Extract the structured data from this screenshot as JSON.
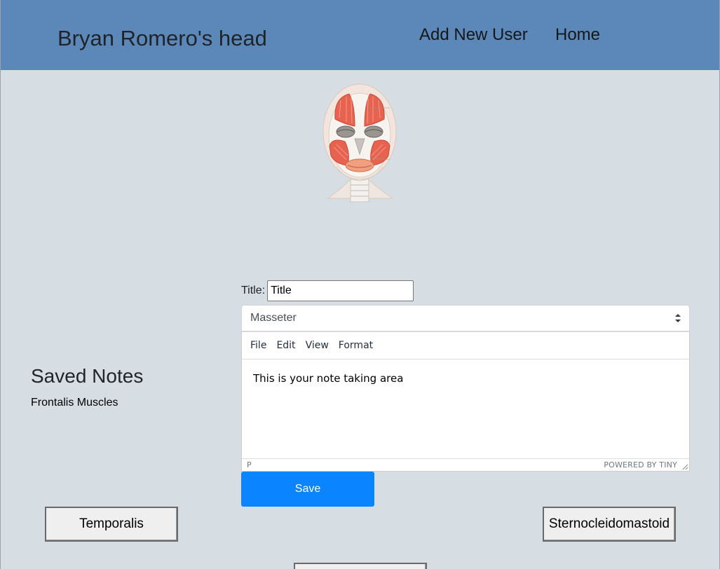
{
  "header": {
    "title": "Bryan Romero's head",
    "nav": {
      "add_user": "Add New User",
      "home": "Home"
    }
  },
  "illustration": {
    "icon": "anatomical-head-icon"
  },
  "note_form": {
    "title_label": "Title:",
    "title_value": "Title",
    "muscle_select": {
      "selected": "Masseter"
    },
    "editor": {
      "menu": [
        "File",
        "Edit",
        "View",
        "Format"
      ],
      "content": "This is your note taking area",
      "status_path": "P",
      "branding": "POWERED BY TINY"
    },
    "save_label": "Save"
  },
  "saved_notes": {
    "heading": "Saved Notes",
    "items": [
      "Frontalis Muscles"
    ]
  },
  "muscle_buttons": {
    "left": "Temporalis",
    "right": "Sternocleidomastoid",
    "bottom": ""
  },
  "colors": {
    "header_bg": "#5b87b9",
    "page_bg": "#d6dde3",
    "save_bg": "#0b84ff",
    "muscle": "#e8634f"
  }
}
